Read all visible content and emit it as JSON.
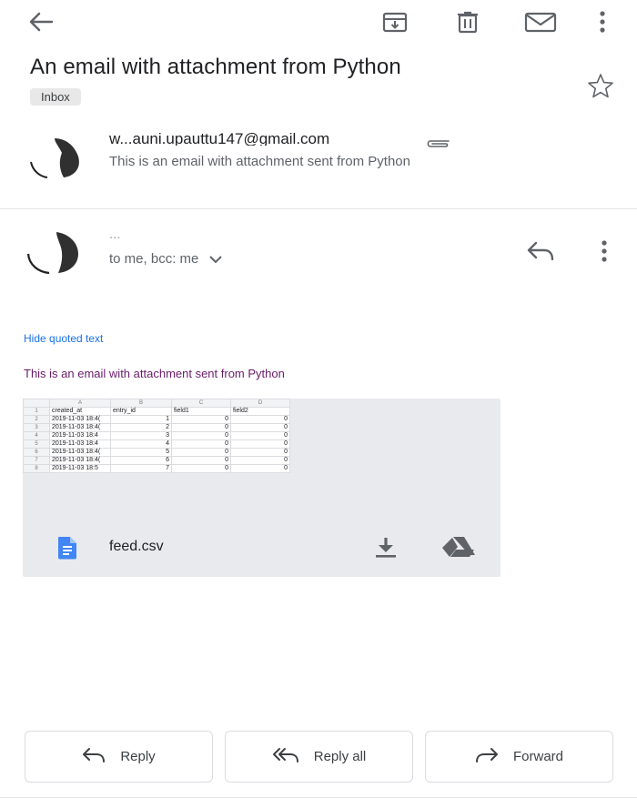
{
  "toolbar": {
    "back_icon": "arrow-left-icon",
    "archive_icon": "archive-icon",
    "delete_icon": "trash-icon",
    "mark_unread_icon": "envelope-icon",
    "more_icon": "more-vert-icon"
  },
  "subject": "An email with attachment from Python",
  "label": "Inbox",
  "messages": [
    {
      "sender": "w...auni.upauttu147@gmail.com",
      "snippet": "This is an email with attachment sent from Python",
      "has_attachment_icon": "paperclip-icon"
    },
    {
      "sender": "...",
      "recipients": "to me, bcc: me",
      "hide_quoted": "Hide quoted text",
      "body": "This is an email with attachment sent from Python"
    }
  ],
  "attachment": {
    "file_name": "feed.csv",
    "preview": {
      "columns": [
        "A",
        "B",
        "C",
        "D"
      ],
      "header": [
        "created_at",
        "entry_id",
        "field1",
        "field2"
      ],
      "rows": [
        [
          "2019-11-03 18:4(",
          "1",
          "0",
          "0"
        ],
        [
          "2019-11-03 18:4(",
          "2",
          "0",
          "0"
        ],
        [
          "2019-11-03 18:4",
          "3",
          "0",
          "0"
        ],
        [
          "2019-11-03 18:4",
          "4",
          "0",
          "0"
        ],
        [
          "2019-11-03 18:4(",
          "5",
          "0",
          "0"
        ],
        [
          "2019-11-03 18:4(",
          "6",
          "0",
          "0"
        ],
        [
          "2019-11-03 18:5",
          "7",
          "0",
          "0"
        ]
      ]
    }
  },
  "actions": {
    "reply": "Reply",
    "reply_all": "Reply all",
    "forward": "Forward"
  },
  "colors": {
    "link": "#1a73e8",
    "body_text": "#6a1b6a",
    "doc_icon": "#4285f4",
    "card_bg": "#e8eaed"
  }
}
